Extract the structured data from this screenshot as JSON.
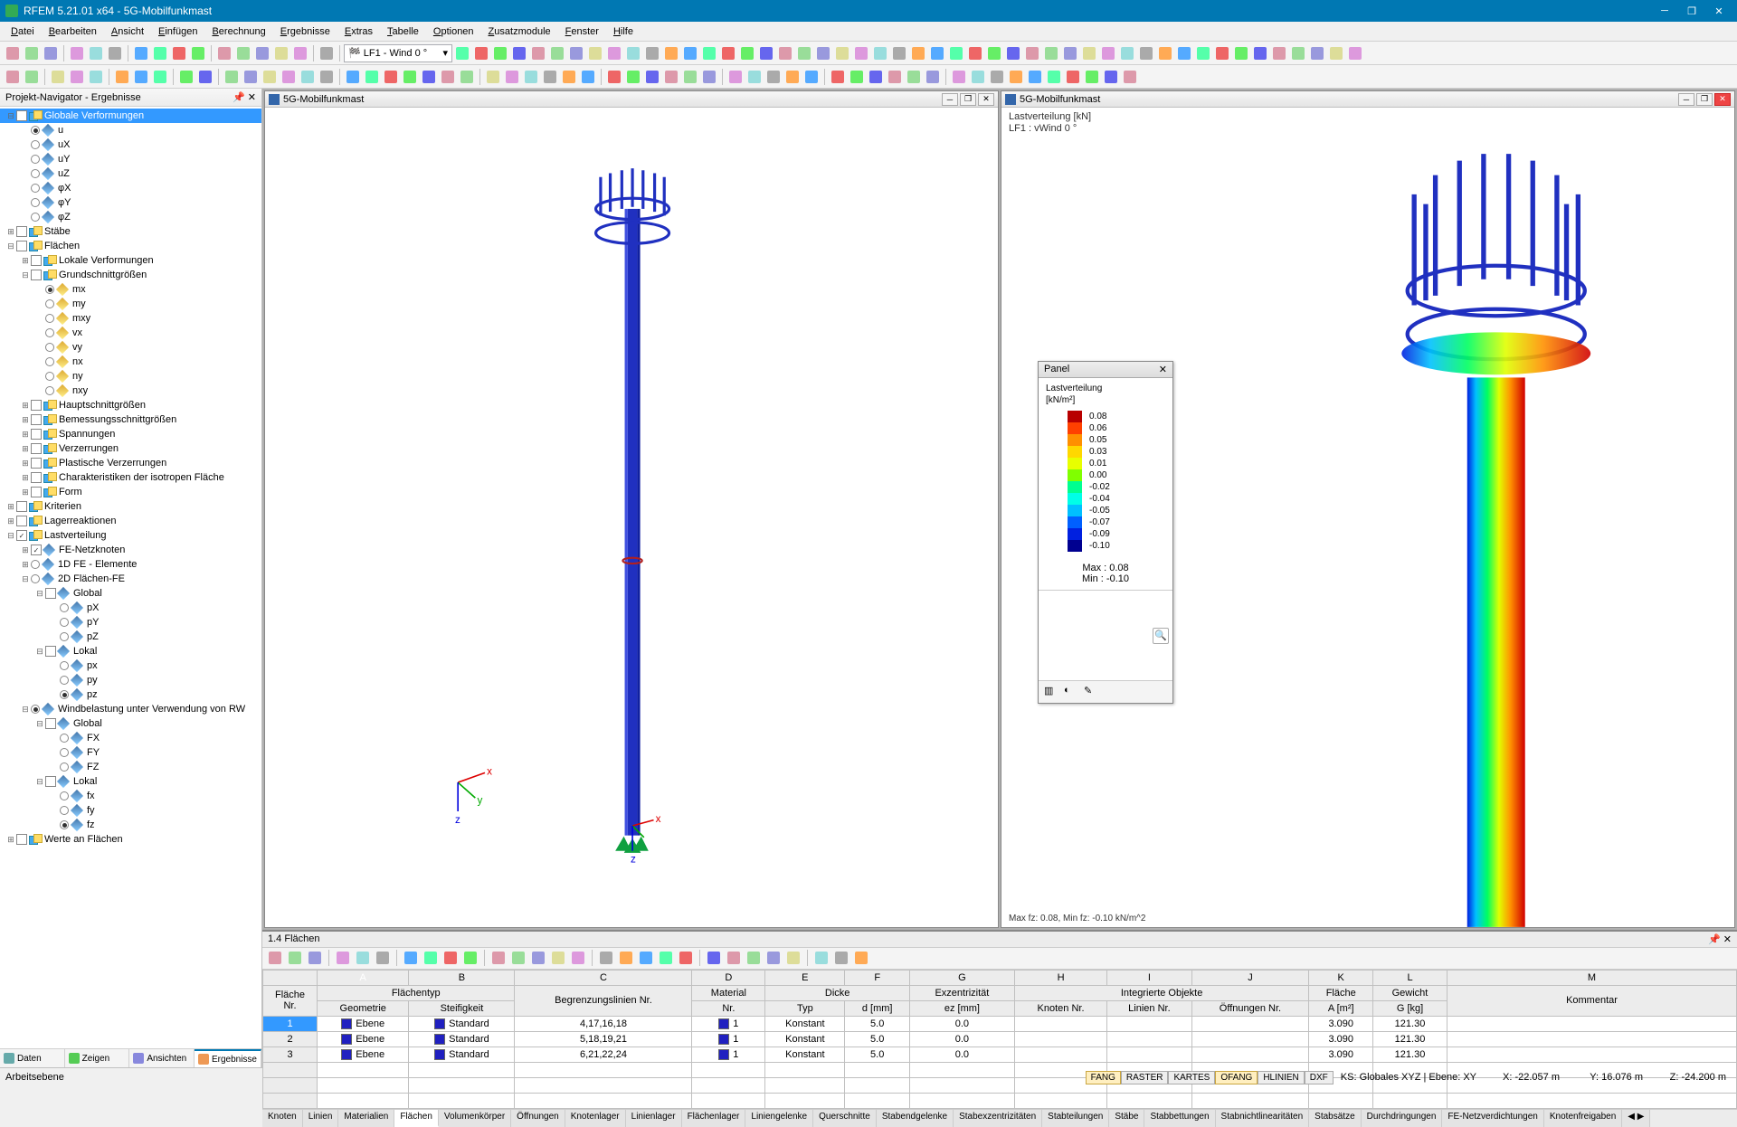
{
  "app": {
    "title": "RFEM 5.21.01 x64 - 5G-Mobilfunkmast"
  },
  "menu": [
    "Datei",
    "Bearbeiten",
    "Ansicht",
    "Einfügen",
    "Berechnung",
    "Ergebnisse",
    "Extras",
    "Tabelle",
    "Optionen",
    "Zusatzmodule",
    "Fenster",
    "Hilfe"
  ],
  "toolbar2_combo": "LF1 - Wind 0 °",
  "sidebar": {
    "title": "Projekt-Navigator - Ergebnisse",
    "tabs": [
      {
        "label": "Daten",
        "icon": "#6aa"
      },
      {
        "label": "Zeigen",
        "icon": "#5c5"
      },
      {
        "label": "Ansichten",
        "icon": "#88d"
      },
      {
        "label": "Ergebnisse",
        "icon": "#e95",
        "active": true
      }
    ],
    "tree": [
      {
        "d": 0,
        "exp": "-",
        "chk": "off",
        "ico": "overlap",
        "label": "Globale Verformungen",
        "sel": true
      },
      {
        "d": 1,
        "radio": "on",
        "ico": "diamond",
        "label": "u"
      },
      {
        "d": 1,
        "radio": "off",
        "ico": "diamond",
        "label": "uX"
      },
      {
        "d": 1,
        "radio": "off",
        "ico": "diamond",
        "label": "uY"
      },
      {
        "d": 1,
        "radio": "off",
        "ico": "diamond",
        "label": "uZ"
      },
      {
        "d": 1,
        "radio": "off",
        "ico": "diamond",
        "label": "φX"
      },
      {
        "d": 1,
        "radio": "off",
        "ico": "diamond",
        "label": "φY"
      },
      {
        "d": 1,
        "radio": "off",
        "ico": "diamond",
        "label": "φZ"
      },
      {
        "d": 0,
        "exp": "+",
        "chk": "off",
        "ico": "overlap",
        "label": "Stäbe"
      },
      {
        "d": 0,
        "exp": "-",
        "chk": "off",
        "ico": "overlap",
        "label": "Flächen"
      },
      {
        "d": 1,
        "exp": "+",
        "chk": "off",
        "ico": "overlap",
        "label": "Lokale Verformungen"
      },
      {
        "d": 1,
        "exp": "-",
        "chk": "off",
        "ico": "overlap",
        "label": "Grundschnittgrößen"
      },
      {
        "d": 2,
        "radio": "on",
        "ico": "diamondY",
        "label": "mx"
      },
      {
        "d": 2,
        "radio": "off",
        "ico": "diamondY",
        "label": "my"
      },
      {
        "d": 2,
        "radio": "off",
        "ico": "diamondY",
        "label": "mxy"
      },
      {
        "d": 2,
        "radio": "off",
        "ico": "diamondY",
        "label": "vx"
      },
      {
        "d": 2,
        "radio": "off",
        "ico": "diamondY",
        "label": "vy"
      },
      {
        "d": 2,
        "radio": "off",
        "ico": "diamondY",
        "label": "nx"
      },
      {
        "d": 2,
        "radio": "off",
        "ico": "diamondY",
        "label": "ny"
      },
      {
        "d": 2,
        "radio": "off",
        "ico": "diamondY",
        "label": "nxy"
      },
      {
        "d": 1,
        "exp": "+",
        "chk": "off",
        "ico": "overlap",
        "label": "Hauptschnittgrößen"
      },
      {
        "d": 1,
        "exp": "+",
        "chk": "off",
        "ico": "overlap",
        "label": "Bemessungsschnittgrößen"
      },
      {
        "d": 1,
        "exp": "+",
        "chk": "off",
        "ico": "overlap",
        "label": "Spannungen"
      },
      {
        "d": 1,
        "exp": "+",
        "chk": "off",
        "ico": "overlap",
        "label": "Verzerrungen"
      },
      {
        "d": 1,
        "exp": "+",
        "chk": "off",
        "ico": "overlap",
        "label": "Plastische Verzerrungen"
      },
      {
        "d": 1,
        "exp": "+",
        "chk": "off",
        "ico": "overlap",
        "label": "Charakteristiken der isotropen Fläche"
      },
      {
        "d": 1,
        "exp": "+",
        "chk": "off",
        "ico": "overlap",
        "label": "Form"
      },
      {
        "d": 0,
        "exp": "+",
        "chk": "off",
        "ico": "overlap",
        "label": "Kriterien"
      },
      {
        "d": 0,
        "exp": "+",
        "chk": "off",
        "ico": "overlap",
        "label": "Lagerreaktionen"
      },
      {
        "d": 0,
        "exp": "-",
        "chk": "on",
        "ico": "overlap",
        "label": "Lastverteilung"
      },
      {
        "d": 1,
        "exp": "+",
        "chk": "on",
        "ico": "diamond",
        "label": "FE-Netzknoten"
      },
      {
        "d": 1,
        "exp": "+",
        "radio": "off",
        "ico": "diamond",
        "label": "1D FE - Elemente"
      },
      {
        "d": 1,
        "exp": "-",
        "radio": "off",
        "ico": "diamond",
        "label": "2D Flächen-FE"
      },
      {
        "d": 2,
        "exp": "-",
        "chk": "off",
        "ico": "diamond",
        "label": "Global"
      },
      {
        "d": 3,
        "radio": "off",
        "ico": "diamond",
        "label": "pX"
      },
      {
        "d": 3,
        "radio": "off",
        "ico": "diamond",
        "label": "pY"
      },
      {
        "d": 3,
        "radio": "off",
        "ico": "diamond",
        "label": "pZ"
      },
      {
        "d": 2,
        "exp": "-",
        "chk": "off",
        "ico": "diamond",
        "label": "Lokal"
      },
      {
        "d": 3,
        "radio": "off",
        "ico": "diamond",
        "label": "px"
      },
      {
        "d": 3,
        "radio": "off",
        "ico": "diamond",
        "label": "py"
      },
      {
        "d": 3,
        "radio": "on",
        "ico": "diamond",
        "label": "pz"
      },
      {
        "d": 1,
        "exp": "-",
        "radio": "on",
        "ico": "diamond",
        "label": "Windbelastung unter Verwendung von RW"
      },
      {
        "d": 2,
        "exp": "-",
        "chk": "off",
        "ico": "diamond",
        "label": "Global"
      },
      {
        "d": 3,
        "radio": "off",
        "ico": "diamond",
        "label": "FX"
      },
      {
        "d": 3,
        "radio": "off",
        "ico": "diamond",
        "label": "FY"
      },
      {
        "d": 3,
        "radio": "off",
        "ico": "diamond",
        "label": "FZ"
      },
      {
        "d": 2,
        "exp": "-",
        "chk": "off",
        "ico": "diamond",
        "label": "Lokal"
      },
      {
        "d": 3,
        "radio": "off",
        "ico": "diamond",
        "label": "fx"
      },
      {
        "d": 3,
        "radio": "off",
        "ico": "diamond",
        "label": "fy"
      },
      {
        "d": 3,
        "radio": "on",
        "ico": "diamond",
        "label": "fz"
      },
      {
        "d": 0,
        "exp": "+",
        "chk": "off",
        "ico": "overlap",
        "label": "Werte an Flächen"
      }
    ]
  },
  "viewports": {
    "left": {
      "title": "5G-Mobilfunkmast"
    },
    "right": {
      "title": "5G-Mobilfunkmast",
      "info1": "Lastverteilung [kN]",
      "info2": "LF1 : vWind 0 °",
      "footer": "Max fz: 0.08, Min fz: -0.10 kN/m^2"
    }
  },
  "legend": {
    "title": "Panel",
    "label1": "Lastverteilung",
    "label2": "[kN/m²]",
    "scale": [
      {
        "c": "#b80000",
        "v": "0.08"
      },
      {
        "c": "#ff4000",
        "v": "0.06"
      },
      {
        "c": "#ff9000",
        "v": "0.05"
      },
      {
        "c": "#ffd800",
        "v": "0.03"
      },
      {
        "c": "#e8ff00",
        "v": "0.01"
      },
      {
        "c": "#80ff00",
        "v": "0.00"
      },
      {
        "c": "#00ff90",
        "v": "-0.02"
      },
      {
        "c": "#00ffe8",
        "v": "-0.04"
      },
      {
        "c": "#00c0ff",
        "v": "-0.05"
      },
      {
        "c": "#0060ff",
        "v": "-0.07"
      },
      {
        "c": "#0020e0",
        "v": "-0.09"
      },
      {
        "c": "#000090",
        "v": "-0.10"
      }
    ],
    "max": "Max  :   0.08",
    "min": "Min   :   -0.10"
  },
  "table": {
    "title": "1.4 Flächen",
    "cols": [
      "A",
      "B",
      "C",
      "D",
      "E",
      "F",
      "G",
      "H",
      "I",
      "J",
      "K",
      "L",
      "M"
    ],
    "group_top": {
      "flaeche": "Fläche",
      "flaechentyp": "Flächentyp",
      "material": "Material",
      "dicke": "Dicke",
      "exz": "Exzentrizität",
      "integ": "Integrierte Objekte",
      "area": "Fläche",
      "gewicht": "Gewicht",
      "komm": "Kommentar"
    },
    "group_sub": {
      "nr": "Nr.",
      "geom": "Geometrie",
      "steif": "Steifigkeit",
      "begr": "Begrenzungslinien Nr.",
      "matnr": "Nr.",
      "typ": "Typ",
      "dmm": "d [mm]",
      "ez": "ez [mm]",
      "kn": "Knoten Nr.",
      "ln": "Linien Nr.",
      "on": "Öffnungen Nr.",
      "am": "A [m²]",
      "gkg": "G [kg]"
    },
    "rows": [
      {
        "nr": "1",
        "geom": "Ebene",
        "steif": "Standard",
        "begr": "4,17,16,18",
        "mat": "1",
        "typ": "Konstant",
        "d": "5.0",
        "ez": "0.0",
        "a": "3.090",
        "g": "121.30",
        "sw": "#2020c0",
        "sel": true
      },
      {
        "nr": "2",
        "geom": "Ebene",
        "steif": "Standard",
        "begr": "5,18,19,21",
        "mat": "1",
        "typ": "Konstant",
        "d": "5.0",
        "ez": "0.0",
        "a": "3.090",
        "g": "121.30",
        "sw": "#2020c0"
      },
      {
        "nr": "3",
        "geom": "Ebene",
        "steif": "Standard",
        "begr": "6,21,22,24",
        "mat": "1",
        "typ": "Konstant",
        "d": "5.0",
        "ez": "0.0",
        "a": "3.090",
        "g": "121.30",
        "sw": "#2020c0"
      }
    ],
    "tabs": [
      "Knoten",
      "Linien",
      "Materialien",
      "Flächen",
      "Volumenkörper",
      "Öffnungen",
      "Knotenlager",
      "Linienlager",
      "Flächenlager",
      "Liniengelenke",
      "Querschnitte",
      "Stabendgelenke",
      "Stabexzentrizitäten",
      "Stabteilungen",
      "Stäbe",
      "Stabbettungen",
      "Stabnichtlinearitäten",
      "Stabsätze",
      "Durchdringungen",
      "FE-Netzverdichtungen",
      "Knotenfreigaben"
    ],
    "active_tab": 3
  },
  "status": {
    "left": "Arbeitsebene",
    "toggles": [
      "FANG",
      "RASTER",
      "KARTES",
      "OFANG",
      "HLINIEN",
      "DXF"
    ],
    "ks": "KS: Globales XYZ | Ebene: XY",
    "x": "X: -22.057 m",
    "y": "Y:  16.076 m",
    "z": "Z:  -24.200 m"
  }
}
